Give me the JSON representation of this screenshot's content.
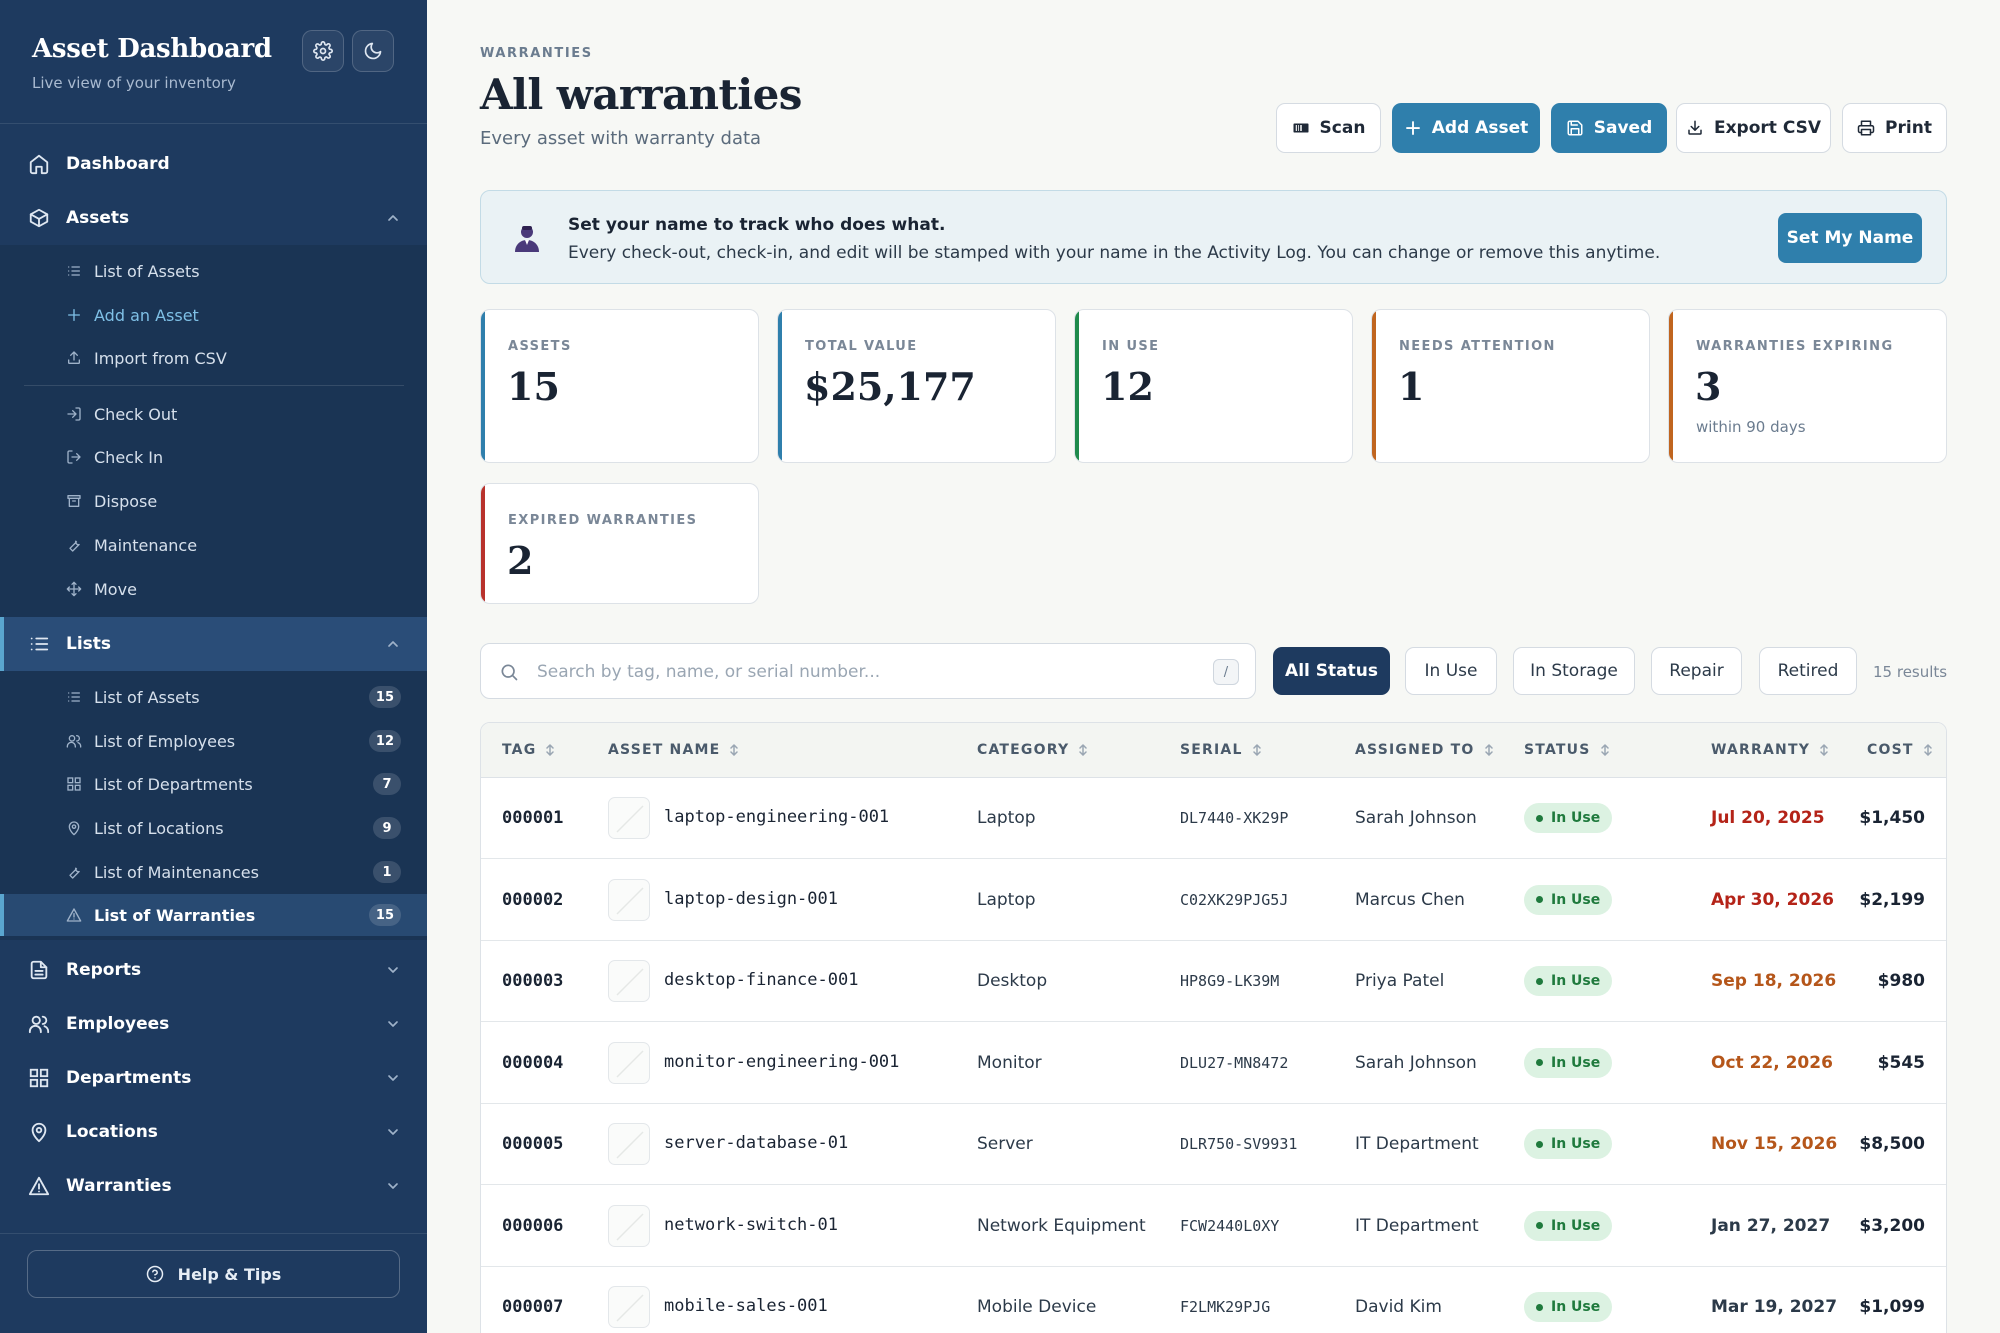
{
  "sidebar": {
    "title": "Asset Dashboard",
    "subtitle": "Live view of your inventory",
    "settings_icon": "gear-icon",
    "theme_icon": "moon-icon",
    "nav": {
      "dashboard": "Dashboard",
      "assets": "Assets",
      "lists": "Lists",
      "reports": "Reports",
      "employees": "Employees",
      "departments": "Departments",
      "locations": "Locations",
      "warranties": "Warranties"
    },
    "assets_sub": {
      "list_of_assets": "List of Assets",
      "add_an_asset": "Add an Asset",
      "import_from_csv": "Import from CSV",
      "check_out": "Check Out",
      "check_in": "Check In",
      "dispose": "Dispose",
      "maintenance": "Maintenance",
      "move": "Move"
    },
    "lists_sub": [
      {
        "label": "List of Assets",
        "count": "15"
      },
      {
        "label": "List of Employees",
        "count": "12"
      },
      {
        "label": "List of Departments",
        "count": "7"
      },
      {
        "label": "List of Locations",
        "count": "9"
      },
      {
        "label": "List of Maintenances",
        "count": "1"
      },
      {
        "label": "List of Warranties",
        "count": "15"
      }
    ],
    "help_label": "Help & Tips"
  },
  "header": {
    "eyebrow": "WARRANTIES",
    "title": "All warranties",
    "subtitle": "Every asset with warranty data"
  },
  "toolbar": {
    "scan": "Scan",
    "add_asset": "Add Asset",
    "saved": "Saved",
    "export_csv": "Export CSV",
    "print": "Print"
  },
  "banner": {
    "title": "Set your name to track who does what.",
    "text": "Every check-out, check-in, and edit will be stamped with your name in the Activity Log. You can change or remove this anytime.",
    "button": "Set My Name"
  },
  "stats": [
    {
      "label": "ASSETS",
      "value": "15",
      "note": "",
      "accent": "#2f7fac"
    },
    {
      "label": "TOTAL VALUE",
      "value": "$25,177",
      "note": "",
      "accent": "#2f7fac"
    },
    {
      "label": "IN USE",
      "value": "12",
      "note": "",
      "accent": "#1f8a4c"
    },
    {
      "label": "NEEDS ATTENTION",
      "value": "1",
      "note": "",
      "accent": "#c0651f"
    },
    {
      "label": "WARRANTIES EXPIRING",
      "value": "3",
      "note": "within 90 days",
      "accent": "#c0651f"
    },
    {
      "label": "EXPIRED WARRANTIES",
      "value": "2",
      "note": "",
      "accent": "#b8322c"
    }
  ],
  "search": {
    "placeholder": "Search by tag, name, or serial number...",
    "shortcut": "/"
  },
  "filters": {
    "all": "All Status",
    "in_use": "In Use",
    "in_storage": "In Storage",
    "repair": "Repair",
    "retired": "Retired",
    "results": "15 results"
  },
  "table": {
    "columns": {
      "tag": "TAG",
      "name": "ASSET NAME",
      "category": "CATEGORY",
      "serial": "SERIAL",
      "assigned": "ASSIGNED TO",
      "status": "STATUS",
      "warranty": "WARRANTY",
      "cost": "COST"
    },
    "rows": [
      {
        "tag": "000001",
        "name": "laptop-engineering-001",
        "category": "Laptop",
        "serial": "DL7440-XK29P",
        "assigned": "Sarah Johnson",
        "status": "In Use",
        "warranty": "Jul 20, 2025",
        "warranty_color": "#b42318",
        "cost": "$1,450"
      },
      {
        "tag": "000002",
        "name": "laptop-design-001",
        "category": "Laptop",
        "serial": "C02XK29PJG5J",
        "assigned": "Marcus Chen",
        "status": "In Use",
        "warranty": "Apr 30, 2026",
        "warranty_color": "#b42318",
        "cost": "$2,199"
      },
      {
        "tag": "000003",
        "name": "desktop-finance-001",
        "category": "Desktop",
        "serial": "HP8G9-LK39M",
        "assigned": "Priya Patel",
        "status": "In Use",
        "warranty": "Sep 18, 2026",
        "warranty_color": "#b5561a",
        "cost": "$980"
      },
      {
        "tag": "000004",
        "name": "monitor-engineering-001",
        "category": "Monitor",
        "serial": "DLU27-MN8472",
        "assigned": "Sarah Johnson",
        "status": "In Use",
        "warranty": "Oct 22, 2026",
        "warranty_color": "#b5561a",
        "cost": "$545"
      },
      {
        "tag": "000005",
        "name": "server-database-01",
        "category": "Server",
        "serial": "DLR750-SV9931",
        "assigned": "IT Department",
        "status": "In Use",
        "warranty": "Nov 15, 2026",
        "warranty_color": "#b5561a",
        "cost": "$8,500"
      },
      {
        "tag": "000006",
        "name": "network-switch-01",
        "category": "Network Equipment",
        "serial": "FCW2440L0XY",
        "assigned": "IT Department",
        "status": "In Use",
        "warranty": "Jan 27, 2027",
        "warranty_color": "#2c3a49",
        "cost": "$3,200"
      },
      {
        "tag": "000007",
        "name": "mobile-sales-001",
        "category": "Mobile Device",
        "serial": "F2LMK29PJG",
        "assigned": "David Kim",
        "status": "In Use",
        "warranty": "Mar 19, 2027",
        "warranty_color": "#2c3a49",
        "cost": "$1,099"
      }
    ]
  }
}
